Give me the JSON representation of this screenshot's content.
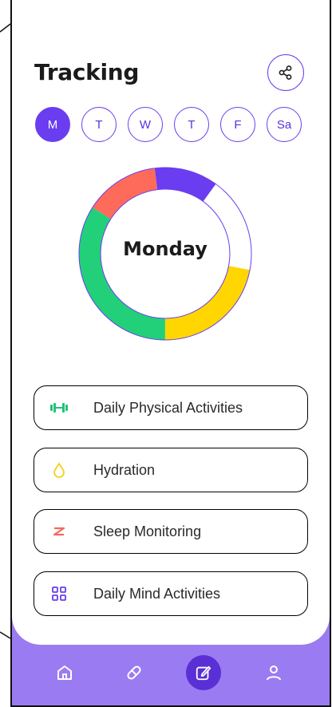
{
  "header": {
    "title": "Tracking"
  },
  "days": [
    {
      "label": "M",
      "active": true
    },
    {
      "label": "T",
      "active": false
    },
    {
      "label": "W",
      "active": false
    },
    {
      "label": "T",
      "active": false
    },
    {
      "label": "F",
      "active": false
    },
    {
      "label": "Sa",
      "active": false
    }
  ],
  "ring": {
    "label": "Monday",
    "segments": [
      {
        "color": "#6a3df0",
        "fraction": 0.12
      },
      {
        "color": "#ffffff",
        "fraction": 0.18
      },
      {
        "color": "#ffd600",
        "fraction": 0.22
      },
      {
        "color": "#22d07a",
        "fraction": 0.34
      },
      {
        "color": "#ff6b5b",
        "fraction": 0.14
      }
    ]
  },
  "activities": [
    {
      "label": "Daily Physical Activities",
      "color": "#22c27a",
      "icon": "dumbbell-icon"
    },
    {
      "label": "Hydration",
      "color": "#f2d21a",
      "icon": "water-drop-icon"
    },
    {
      "label": "Sleep Monitoring",
      "color": "#f06b5f",
      "icon": "sleep-z-icon"
    },
    {
      "label": "Daily Mind Activities",
      "color": "#6a3df0",
      "icon": "grid-icon"
    }
  ],
  "nav": [
    {
      "icon": "home-icon",
      "active": false
    },
    {
      "icon": "pill-icon",
      "active": false
    },
    {
      "icon": "edit-icon",
      "active": true
    },
    {
      "icon": "profile-icon",
      "active": false
    }
  ],
  "colors": {
    "accent": "#6a3df0",
    "nav_bg": "#9b7bf2"
  }
}
